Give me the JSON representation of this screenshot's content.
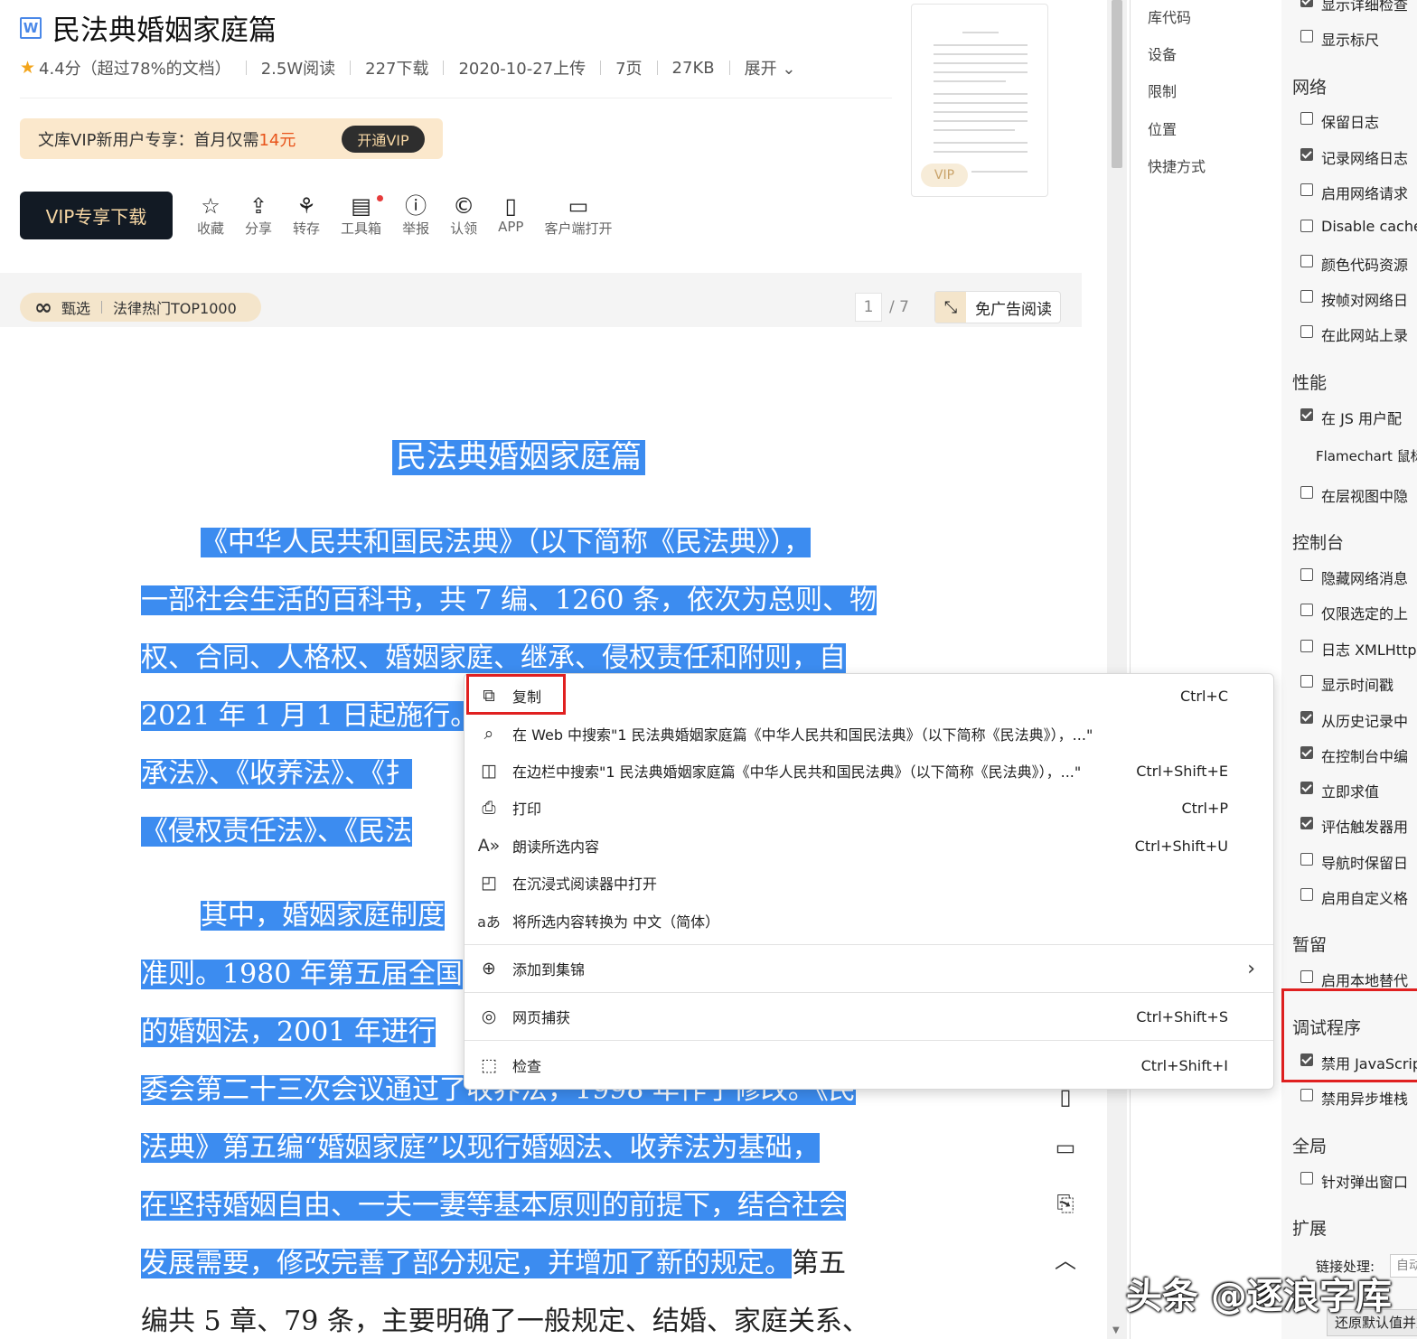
{
  "doc": {
    "title": "民法典婚姻家庭篇",
    "file_icon": "W",
    "rating": "4.4分（超过78%的文档）",
    "reads": "2.5W阅读",
    "downloads": "227下载",
    "upload_date": "2020-10-27上传",
    "pages": "7页",
    "size": "27KB",
    "expand": "展开",
    "vip_banner_text": "文库VIP新用户专享：首月仅需",
    "vip_banner_price": "14元",
    "vip_open": "开通VIP",
    "download_btn": "VIP专享下载",
    "tools": [
      {
        "icon": "☆",
        "label": "收藏"
      },
      {
        "icon": "⇪",
        "label": "分享"
      },
      {
        "icon": "⚘",
        "label": "转存"
      },
      {
        "icon": "▤",
        "label": "工具箱"
      },
      {
        "icon": "ⓘ",
        "label": "举报"
      },
      {
        "icon": "©",
        "label": "认领"
      },
      {
        "icon": "▯",
        "label": "APP"
      },
      {
        "icon": "▭",
        "label": "客户端打开"
      }
    ],
    "thumb_vip": "VIP",
    "tag_label": "甄选",
    "tag_text": "法律热门TOP1000",
    "page_current": "1",
    "page_total": "/ 7",
    "noad_label": "免广告阅读",
    "heading": "民法典婚姻家庭篇",
    "lines": [
      {
        "hl": "《中华人民共和国民法典》（以下简称《民法典》），",
        "plain": ""
      },
      {
        "hl": "一部社会生活的百科书，共 7 编、1260 条，依次为总则、物",
        "plain": ""
      },
      {
        "hl": "权、合同、人格权、婚姻家庭、继承、侵权责任和附则，自",
        "plain": ""
      },
      {
        "hl": "2021 年 1 月 1 日起施行。",
        "plain": ""
      },
      {
        "hl": "承法》、《收养法》、《扌",
        "plain": ""
      },
      {
        "hl": "《侵权责任法》、《民法",
        "plain": ""
      },
      {
        "hl": "其中，婚姻家庭制度",
        "plain": ""
      },
      {
        "hl": "准则。1980 年第五届全国",
        "plain": ""
      },
      {
        "hl": "的婚姻法，2001 年进行",
        "plain": ""
      },
      {
        "hl": "委会第二十三次会议通过了收养法，1998 年作了修改。《民",
        "plain": ""
      },
      {
        "hl": "法典》第五编“婚姻家庭”以现行婚姻法、收养法为基础，",
        "plain": ""
      },
      {
        "hl": "在坚持婚姻自由、一夫一妻等基本原则的前提下，结合社会",
        "plain": ""
      },
      {
        "hl": "发展需要，修改完善了部分规定，并增加了新的规定。",
        "plain": "第五"
      },
      {
        "hl": "",
        "plain": "编共 5 章、79 条，主要明确了一般规定、结婚、家庭关系、"
      }
    ],
    "side_buttons": [
      "phone-icon",
      "comment-icon",
      "clipboard-icon",
      "back-to-top-icon"
    ]
  },
  "context_menu": {
    "items": [
      {
        "icon": "copy-icon",
        "glyph": "⧉",
        "label": "复制",
        "shortcut": "Ctrl+C"
      },
      {
        "icon": "search-icon",
        "glyph": "⌕",
        "label": "在 Web 中搜索\"1 民法典婚姻家庭篇《中华人民共和国民法典》（以下简称《民法典》），...\"",
        "shortcut": ""
      },
      {
        "icon": "sidebar-search-icon",
        "glyph": "◫",
        "label": "在边栏中搜索\"1 民法典婚姻家庭篇《中华人民共和国民法典》（以下简称《民法典》），...\"",
        "shortcut": "Ctrl+Shift+E"
      },
      {
        "icon": "print-icon",
        "glyph": "⎙",
        "label": "打印",
        "shortcut": "Ctrl+P"
      },
      {
        "icon": "read-aloud-icon",
        "glyph": "A»",
        "label": "朗读所选内容",
        "shortcut": "Ctrl+Shift+U"
      },
      {
        "icon": "immersive-reader-icon",
        "glyph": "◰",
        "label": "在沉浸式阅读器中打开",
        "shortcut": ""
      },
      {
        "icon": "translate-icon",
        "glyph": "aあ",
        "label": "将所选内容转换为 中文（简体）",
        "shortcut": ""
      },
      {
        "icon": "collections-icon",
        "glyph": "⊕",
        "label": "添加到集锦",
        "shortcut": ""
      },
      {
        "icon": "web-capture-icon",
        "glyph": "◎",
        "label": "网页捕获",
        "shortcut": "Ctrl+Shift+S"
      },
      {
        "icon": "inspect-icon",
        "glyph": "⬚",
        "label": "检查",
        "shortcut": "Ctrl+Shift+I"
      }
    ],
    "submenu_chevron": "›"
  },
  "devtools": {
    "nav": [
      "库代码",
      "设备",
      "限制",
      "位置",
      "快捷方式"
    ],
    "settings": {
      "top_partial": "显示详细检查",
      "show_ruler": "显示标尺",
      "network_title": "网络",
      "network": [
        {
          "label": "保留日志",
          "checked": false
        },
        {
          "label": "记录网络日志",
          "checked": true
        },
        {
          "label": "启用网络请求",
          "checked": false
        },
        {
          "label": "Disable cache",
          "checked": false
        },
        {
          "label": "颜色代码资源",
          "checked": false
        },
        {
          "label": "按帧对网络日",
          "checked": false
        },
        {
          "label": "在此网站上录",
          "checked": false
        }
      ],
      "perf_title": "性能",
      "perf_js": {
        "label": "在 JS 用户配",
        "checked": true
      },
      "flamechart": "Flamechart 鼠标",
      "perf_layer": {
        "label": "在层视图中隐",
        "checked": false
      },
      "console_title": "控制台",
      "console": [
        {
          "label": "隐藏网络消息",
          "checked": false
        },
        {
          "label": "仅限选定的上",
          "checked": false
        },
        {
          "label": "日志 XMLHttp",
          "checked": false
        },
        {
          "label": "显示时间戳",
          "checked": false
        },
        {
          "label": "从历史记录中",
          "checked": true
        },
        {
          "label": "在控制台中编",
          "checked": true
        },
        {
          "label": "立即求值",
          "checked": true
        },
        {
          "label": "评估触发器用",
          "checked": true
        },
        {
          "label": "导航时保留日",
          "checked": false
        },
        {
          "label": "启用自定义格",
          "checked": false
        }
      ],
      "persist_title": "暂留",
      "persist_local": {
        "label": "启用本地替代",
        "checked": false
      },
      "debugger_title": "调试程序",
      "debugger_js": {
        "label": "禁用 JavaScript",
        "checked": true
      },
      "debugger_async": {
        "label": "禁用异步堆栈",
        "checked": false
      },
      "global_title": "全局",
      "global_popup": {
        "label": "针对弹出窗口",
        "checked": false
      },
      "ext_title": "扩展",
      "link_handling": "链接处理:",
      "link_value": "自动",
      "restore_btn": "还原默认值并重新加载"
    }
  },
  "watermark": "头条 @逐浪字库"
}
